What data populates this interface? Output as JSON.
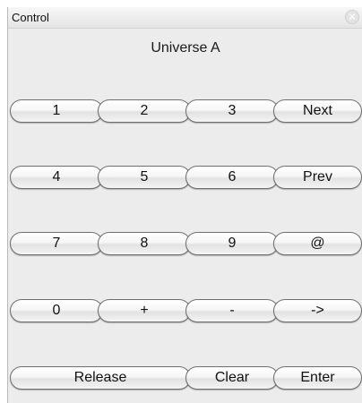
{
  "window": {
    "title": "Control",
    "close_glyph": "✕",
    "close_icon": "close-icon"
  },
  "universe_label": "Universe A",
  "rows": [
    [
      "1",
      "2",
      "3",
      "Next"
    ],
    [
      "4",
      "5",
      "6",
      "Prev"
    ],
    [
      "7",
      "8",
      "9",
      "@"
    ],
    [
      "0",
      "+",
      "-",
      "->"
    ]
  ],
  "bottom": {
    "release": "Release",
    "clear": "Clear",
    "enter": "Enter"
  }
}
